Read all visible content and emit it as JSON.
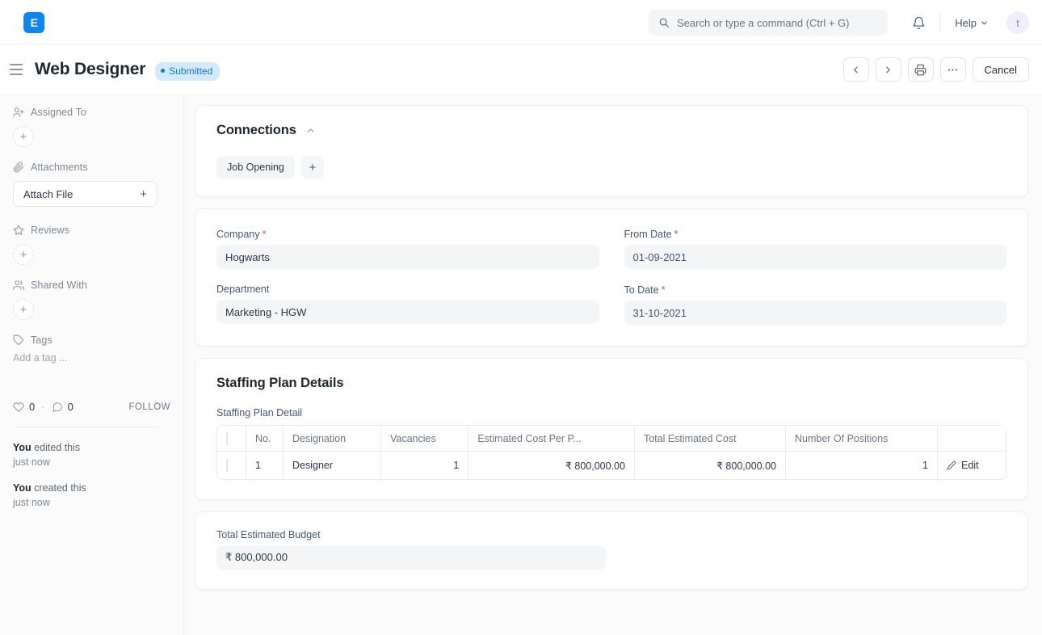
{
  "navbar": {
    "logo_text": "E",
    "search": {
      "placeholder": "Search or type a command (Ctrl + G)",
      "icon": "search-icon"
    },
    "bell_icon": "bell-icon",
    "help_label": "Help",
    "help_chevron": "chevron-down-icon",
    "avatar_initial": "t"
  },
  "page_head": {
    "menu_icon": "hamburger-icon",
    "title": "Web Designer",
    "status": "Submitted",
    "actions": {
      "prev": "chevron-left-icon",
      "next": "chevron-right-icon",
      "print": "printer-icon",
      "more": "ellipsis-icon",
      "cancel_label": "Cancel"
    }
  },
  "sidebar": {
    "assigned_to": {
      "label": "Assigned To",
      "icon": "user-plus-icon",
      "add": "+"
    },
    "attachments": {
      "label": "Attachments",
      "icon": "paperclip-icon",
      "button_label": "Attach File",
      "add": "+"
    },
    "reviews": {
      "label": "Reviews",
      "icon": "star-icon",
      "add": "+"
    },
    "shared_with": {
      "label": "Shared With",
      "icon": "users-icon",
      "add": "+"
    },
    "tags": {
      "label": "Tags",
      "icon": "tag-icon",
      "placeholder": "Add a tag ..."
    },
    "meta": {
      "like_icon": "heart-icon",
      "like_count": "0",
      "separator": "·",
      "comment_icon": "comment-icon",
      "comment_count": "0",
      "follow_label": "FOLLOW"
    },
    "activity": [
      {
        "actor": "You",
        "action": " edited this",
        "when": "just now"
      },
      {
        "actor": "You",
        "action": " created this",
        "when": "just now"
      }
    ]
  },
  "main": {
    "connections": {
      "title": "Connections",
      "collapse_icon": "chevron-up-icon",
      "pills": [
        "Job Opening"
      ],
      "add_label": "+"
    },
    "details": {
      "fields": [
        {
          "label": "Company",
          "required": true,
          "value": "Hogwarts"
        },
        {
          "label": "From Date",
          "required": true,
          "value": "01-09-2021"
        },
        {
          "label": "Department",
          "required": false,
          "value": "Marketing - HGW"
        },
        {
          "label": "To Date",
          "required": true,
          "value": "31-10-2021"
        }
      ]
    },
    "staffing": {
      "title": "Staffing Plan Details",
      "grid_label": "Staffing Plan Detail",
      "columns": [
        "No.",
        "Designation",
        "Vacancies",
        "Estimated Cost Per P...",
        "Total Estimated Cost",
        "Number Of Positions",
        ""
      ],
      "rows": [
        {
          "no": "1",
          "designation": "Designer",
          "vacancies": "1",
          "estimated_cost_per_position": "₹ 800,000.00",
          "total_estimated_cost": "₹ 800,000.00",
          "number_of_positions": "1",
          "edit_label": "Edit",
          "edit_icon": "pencil-icon"
        }
      ]
    },
    "budget": {
      "label": "Total Estimated Budget",
      "value": "₹ 800,000.00"
    }
  },
  "colors": {
    "brand": "#0d87ec",
    "status_badge_bg": "#d3e9fc",
    "status_badge_text": "#1579d0",
    "required_star": "#e24c4c",
    "page_bg": "#fbfbfc",
    "card_bg": "#ffffff"
  }
}
